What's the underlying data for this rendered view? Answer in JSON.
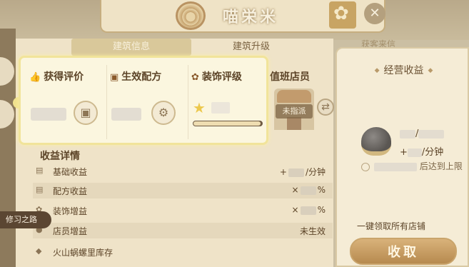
{
  "header": {
    "shop_title": "喵栄米",
    "close_icon": "leaf-close-icon"
  },
  "tabs": [
    {
      "label": "建筑信息",
      "active": true
    },
    {
      "label": "建筑升级",
      "active": false
    },
    {
      "label": "获客来信",
      "active": false
    }
  ],
  "popup": {
    "rating": {
      "label": "获得评价",
      "icon": "thumbs-up-icon"
    },
    "recipe": {
      "label": "生效配方",
      "icon": "recipe-book-icon"
    },
    "decor": {
      "label": "装饰评级",
      "icon": "flower-icon",
      "progress": 0.98
    }
  },
  "duty": {
    "label": "值班店员",
    "unassigned": "未指派"
  },
  "income": {
    "title": "收益详情",
    "rows": [
      {
        "label": "基础收益",
        "prefix": "+",
        "suffix": "/分钟"
      },
      {
        "label": "配方收益",
        "prefix": "×",
        "suffix": "%"
      },
      {
        "label": "装饰增益",
        "prefix": "×",
        "suffix": "%"
      },
      {
        "label": "店员增益",
        "prefix": "",
        "suffix": "未生效"
      },
      {
        "label": "火山蜗螺里库存",
        "prefix": "",
        "suffix": ""
      }
    ]
  },
  "side_tag": "修习之路",
  "business": {
    "title": "经营收益",
    "amount_sep": "/",
    "rate_prefix": "+",
    "rate_suffix": "/分钟",
    "limit_text": "后达到上限",
    "footer": "一键领取所有店铺",
    "collect_label": "收取"
  },
  "colors": {
    "panel": "#efe3c8",
    "highlight": "#f1e49a",
    "accent": "#b78a4f"
  }
}
